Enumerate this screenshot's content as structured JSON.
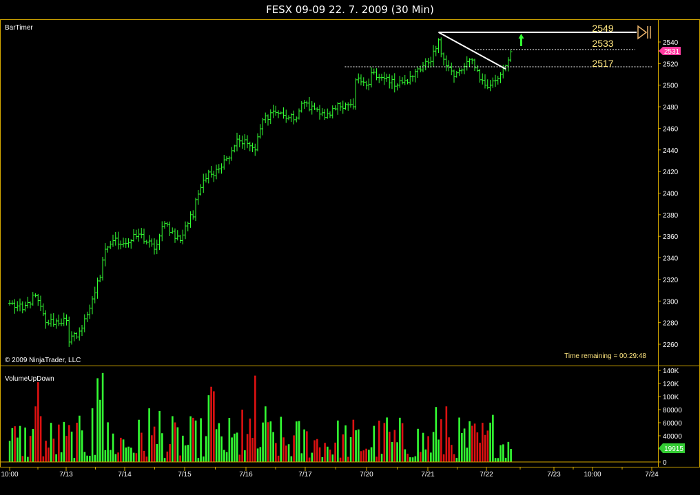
{
  "window": {
    "title": "FESX 09-09  22. 7. 2009 (30 Min)"
  },
  "price_panel": {
    "indicator_label": "BarTimer",
    "copyright": "© 2009 NinjaTrader, LLC",
    "time_remaining": "Time remaining = 00:29:48",
    "current_price_tag": "2531",
    "level_labels": [
      "2549",
      "2533",
      "2517"
    ]
  },
  "volume_panel": {
    "indicator_label": "VolumeUpDown",
    "current_volume_tag": "19915"
  },
  "colors": {
    "background": "#000000",
    "up_bar": "#33ff33",
    "down_bar": "#dd1111",
    "axis": "#d4a800",
    "level_label": "#ffe680",
    "price_tag": "#ff3aa0",
    "volume_tag": "#33cc33",
    "tool_marker": "#e8b26a"
  },
  "chart_data": [
    {
      "type": "ohlc",
      "title": "FESX 09-09  22. 7. 2009 (30 Min)",
      "ylim": [
        2250,
        2560
      ],
      "y_ticks": [
        2260,
        2280,
        2300,
        2320,
        2340,
        2360,
        2380,
        2400,
        2420,
        2440,
        2460,
        2480,
        2500,
        2520,
        2540
      ],
      "x_ticks": [
        "10:00",
        "7/13",
        "7/14",
        "7/15",
        "7/16",
        "7/17",
        "7/20",
        "7/21",
        "7/22",
        "7/23",
        "10:00",
        "7/24"
      ],
      "bars_per_day": 23,
      "close_path": [
        [
          0,
          2298
        ],
        [
          5,
          2292
        ],
        [
          10,
          2305
        ],
        [
          14,
          2280
        ],
        [
          22,
          2282
        ],
        [
          23,
          2262
        ],
        [
          28,
          2275
        ],
        [
          32,
          2302
        ],
        [
          35,
          2322
        ],
        [
          37,
          2348
        ],
        [
          40,
          2356
        ],
        [
          46,
          2354
        ],
        [
          50,
          2362
        ],
        [
          56,
          2348
        ],
        [
          60,
          2372
        ],
        [
          66,
          2356
        ],
        [
          70,
          2380
        ],
        [
          71,
          2378
        ],
        [
          72,
          2394
        ],
        [
          75,
          2412
        ],
        [
          80,
          2422
        ],
        [
          84,
          2432
        ],
        [
          88,
          2450
        ],
        [
          92,
          2446
        ],
        [
          95,
          2440
        ],
        [
          98,
          2468
        ],
        [
          102,
          2476
        ],
        [
          106,
          2472
        ],
        [
          110,
          2468
        ],
        [
          114,
          2484
        ],
        [
          118,
          2478
        ],
        [
          122,
          2470
        ],
        [
          126,
          2478
        ],
        [
          130,
          2482
        ],
        [
          133,
          2480
        ],
        [
          134,
          2505
        ],
        [
          138,
          2500
        ],
        [
          141,
          2512
        ],
        [
          145,
          2506
        ],
        [
          150,
          2500
        ],
        [
          155,
          2508
        ],
        [
          159,
          2514
        ],
        [
          163,
          2522
        ],
        [
          166,
          2542
        ],
        [
          168,
          2524
        ],
        [
          172,
          2508
        ],
        [
          175,
          2514
        ],
        [
          178,
          2524
        ],
        [
          180,
          2516
        ],
        [
          184,
          2500
        ],
        [
          186,
          2500
        ],
        [
          190,
          2510
        ],
        [
          192,
          2518
        ],
        [
          194,
          2531
        ]
      ],
      "current_price": 2531,
      "horizontal_levels": [
        {
          "value": 2549,
          "label": "2549",
          "style": "solid"
        },
        {
          "value": 2533,
          "label": "2533",
          "style": "dotted"
        },
        {
          "value": 2517,
          "label": "2517",
          "style": "dotted"
        }
      ],
      "trend_line": {
        "from": {
          "bar": 166,
          "price": 2549
        },
        "to": {
          "bar": 192,
          "price": 2515
        }
      },
      "up_arrow": {
        "bar": 198,
        "price": 2540
      }
    },
    {
      "type": "bar",
      "title": "VolumeUpDown",
      "ylim": [
        0,
        145000
      ],
      "y_ticks": [
        0,
        20000,
        40000,
        60000,
        80000,
        100000,
        120000,
        140000
      ],
      "y_tick_labels": [
        "0",
        "20000",
        "40000",
        "60000",
        "80000",
        "100K",
        "120K",
        "140K"
      ],
      "current_volume": 19915,
      "volume_peaks": [
        {
          "bar": 10,
          "value": 85000
        },
        {
          "bar": 11,
          "value": 122000
        },
        {
          "bar": 12,
          "value": 70000
        },
        {
          "bar": 32,
          "value": 82000
        },
        {
          "bar": 34,
          "value": 128000
        },
        {
          "bar": 35,
          "value": 95000
        },
        {
          "bar": 36,
          "value": 136000
        },
        {
          "bar": 54,
          "value": 82000
        },
        {
          "bar": 58,
          "value": 78000
        },
        {
          "bar": 77,
          "value": 102000
        },
        {
          "bar": 78,
          "value": 115000
        },
        {
          "bar": 79,
          "value": 108000
        },
        {
          "bar": 90,
          "value": 80000
        },
        {
          "bar": 95,
          "value": 132000
        },
        {
          "bar": 99,
          "value": 85000
        },
        {
          "bar": 101,
          "value": 62000
        },
        {
          "bar": 146,
          "value": 68000
        },
        {
          "bar": 165,
          "value": 84000
        },
        {
          "bar": 169,
          "value": 85000
        },
        {
          "bar": 187,
          "value": 72000
        }
      ]
    }
  ]
}
